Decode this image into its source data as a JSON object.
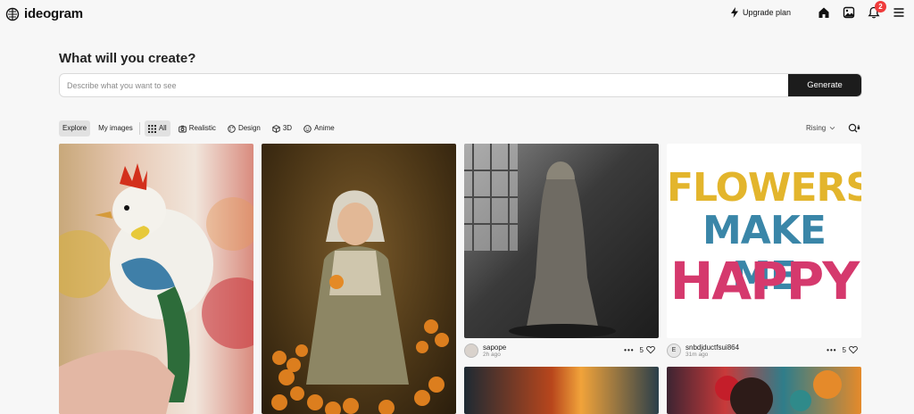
{
  "brand": {
    "name": "ideogram"
  },
  "header": {
    "upgrade_label": "Upgrade plan",
    "notification_count": "2",
    "icons": [
      "lightning-icon",
      "home-icon",
      "gallery-icon",
      "bell-icon",
      "menu-icon"
    ]
  },
  "create": {
    "heading": "What will you create?",
    "placeholder": "Describe what you want to see",
    "value": "",
    "generate_label": "Generate"
  },
  "filters": {
    "tabs": [
      "Explore",
      "My images"
    ],
    "active_tab": "Explore",
    "styles": [
      "All",
      "Realistic",
      "Design",
      "3D",
      "Anime"
    ],
    "active_style": "All",
    "sort_label": "Rising"
  },
  "feed": {
    "cards": [
      {
        "subject": "chick-on-finger"
      },
      {
        "subject": "girl-with-oranges"
      },
      {
        "subject": "ghost-woman",
        "user": "sapope",
        "time": "2h ago",
        "likes": "5"
      },
      {
        "subject": "flowers-make-me-happy",
        "user": "snbdjductfsui864",
        "avatar_letter": "E",
        "time": "31m ago",
        "likes": "5",
        "poster": {
          "line1": "FLOWERS",
          "line2": "MAKE ME",
          "line3": "HAPPY"
        }
      },
      {
        "subject": "fiery-scene"
      },
      {
        "subject": "woman-with-roses"
      }
    ]
  },
  "colors": {
    "accent_dark": "#1c1c1c",
    "badge": "#ef3b3b",
    "background": "#f7f7f7"
  }
}
